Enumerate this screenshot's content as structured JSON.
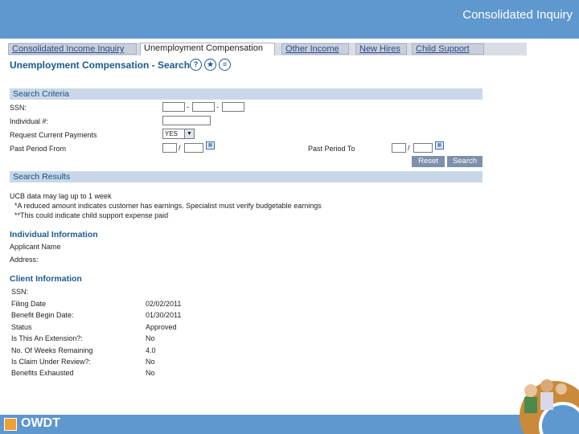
{
  "slide": {
    "title": "Consolidated Inquiry"
  },
  "tabs": [
    {
      "label": "Consolidated Income Inquiry",
      "active": false
    },
    {
      "label": "Unemployment Compensation",
      "active": true
    },
    {
      "label": "Other Income",
      "active": false
    },
    {
      "label": "New Hires",
      "active": false
    },
    {
      "label": "Child Support",
      "active": false
    }
  ],
  "page": {
    "title": "Unemployment Compensation - Search",
    "icons": [
      "help-icon",
      "favorite-icon",
      "list-icon"
    ]
  },
  "search_criteria": {
    "heading": "Search Criteria",
    "ssn_label": "SSN:",
    "ssn_sep": "-",
    "individual_label": "Individual #:",
    "request_payments_label": "Request Current Payments",
    "request_payments_value": "YES",
    "past_from_label": "Past Period From",
    "past_to_label": "Past Period To",
    "date_sep": "/",
    "reset_label": "Reset",
    "search_label": "Search"
  },
  "search_results": {
    "heading": "Search Results",
    "note1": "UCB data may lag up to 1 week",
    "note2": "*A reduced amount indicates customer has earnings. Specialist must verify budgetable earnings",
    "note3": "**This could indicate child support expense paid"
  },
  "individual": {
    "heading": "Individual Information",
    "applicant_label": "Applicant Name",
    "address_label": "Address:"
  },
  "client": {
    "heading": "Client Information",
    "rows": [
      {
        "label": "SSN:",
        "value": ""
      },
      {
        "label": "Filing Date",
        "value": "02/02/2011"
      },
      {
        "label": "Benefit Begin Date:",
        "value": "01/30/2011"
      },
      {
        "label": "Status",
        "value": "Approved"
      },
      {
        "label": "Is This An Extension?:",
        "value": "No"
      },
      {
        "label": "No. Of Weeks Remaining",
        "value": "4.0"
      },
      {
        "label": "Is Claim Under Review?:",
        "value": "No"
      },
      {
        "label": "Benefits Exhausted",
        "value": "No"
      }
    ]
  },
  "footer": {
    "logo_text": "OWDT"
  },
  "colors": {
    "header": "#5f97cf",
    "section_bar": "#c8d8ea",
    "title_blue": "#1b5a8c",
    "button": "#7d90ac"
  }
}
